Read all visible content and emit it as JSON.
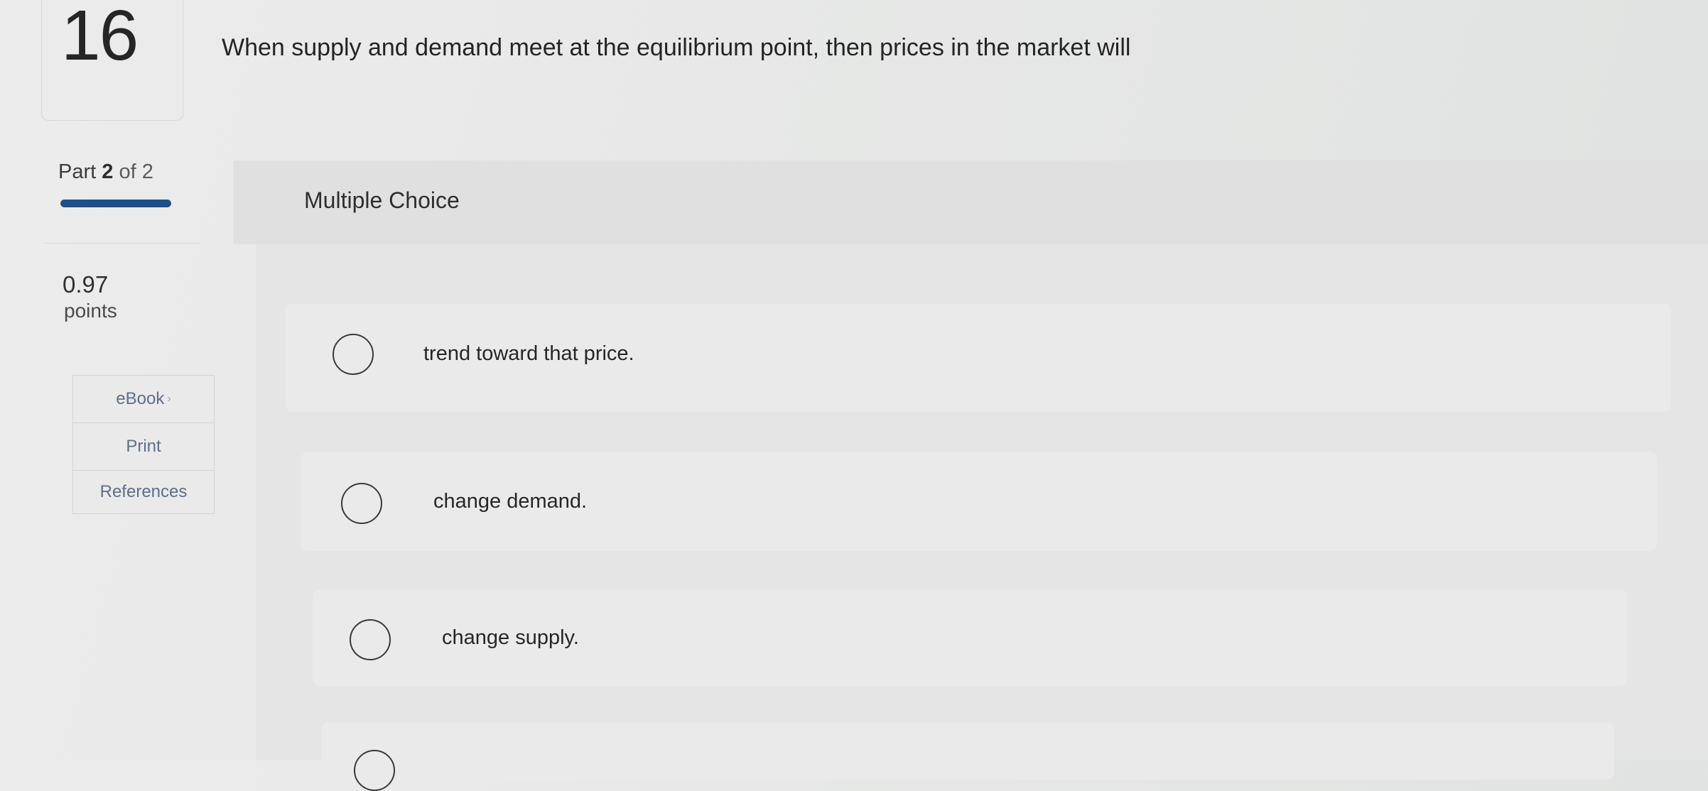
{
  "question": {
    "number": "16",
    "text": "When supply and demand meet at the equilibrium point, then prices in the market will"
  },
  "part": {
    "label_word": "Part",
    "current": "2",
    "of_text": "of 2",
    "progress_fraction": 1.0,
    "progress_color": "#1f4f86"
  },
  "points": {
    "value": "0.97",
    "label": "points"
  },
  "tools": {
    "ebook": "eBook",
    "print": "Print",
    "references": "References"
  },
  "main": {
    "type_title": "Multiple Choice",
    "choices": [
      {
        "text": "trend toward that price."
      },
      {
        "text": "change demand."
      },
      {
        "text": "change supply."
      },
      {
        "text": ""
      }
    ]
  }
}
